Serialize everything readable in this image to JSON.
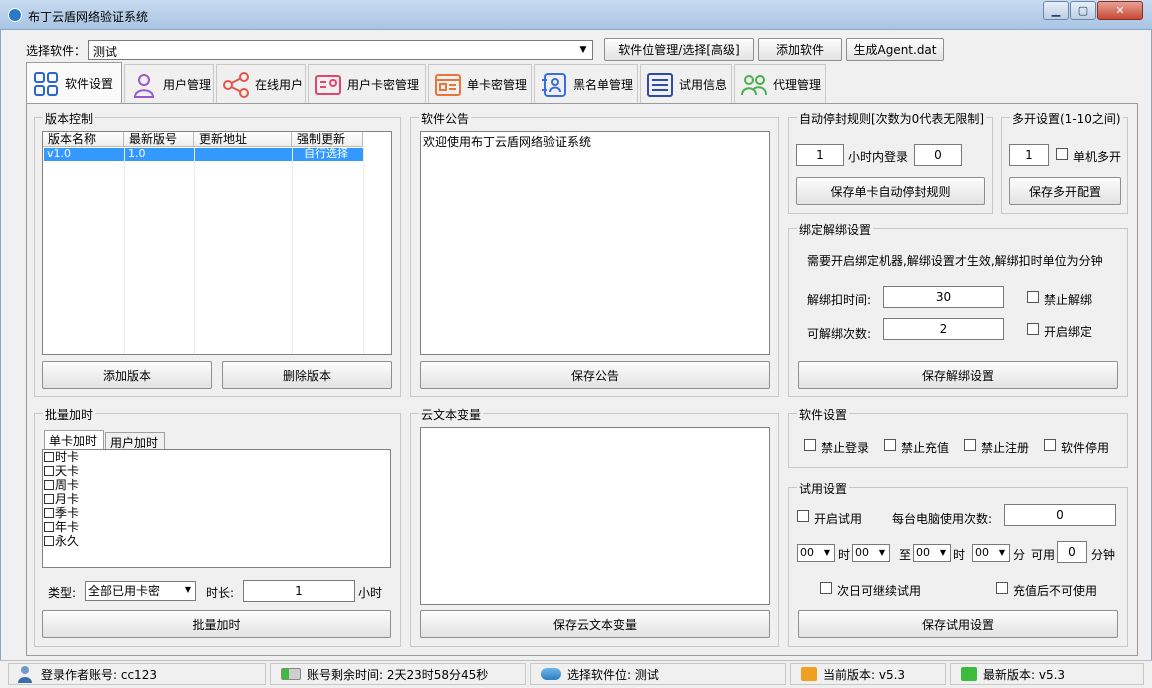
{
  "window": {
    "title": "布丁云盾网络验证系统"
  },
  "toolbar": {
    "select_label": "选择软件：",
    "select_value": "测试",
    "btn_manage": "软件位管理/选择[高级]",
    "btn_add": "添加软件",
    "btn_gen": "生成Agent.dat"
  },
  "tabs": [
    {
      "label": "软件设置"
    },
    {
      "label": "用户管理"
    },
    {
      "label": "在线用户"
    },
    {
      "label": "用户卡密管理"
    },
    {
      "label": "单卡密管理"
    },
    {
      "label": "黑名单管理"
    },
    {
      "label": "试用信息"
    },
    {
      "label": "代理管理"
    }
  ],
  "version": {
    "title": "版本控制",
    "columns": [
      "版本名称",
      "最新版号",
      "更新地址",
      "强制更新"
    ],
    "rows": [
      {
        "name": "v1.0",
        "num": "1.0",
        "url": "",
        "force": "自行选择"
      }
    ],
    "btn_add": "添加版本",
    "btn_del": "删除版本"
  },
  "notice": {
    "title": "软件公告",
    "content": "欢迎使用布丁云盾网络验证系统",
    "btn_save": "保存公告"
  },
  "autoban": {
    "title": "自动停封规则[次数为0代表无限制]",
    "hours": "1",
    "hours_label": "小时内登录",
    "count": "0",
    "btn_save": "保存单卡自动停封规则"
  },
  "multi": {
    "title": "多开设置(1-10之间)",
    "value": "1",
    "check_label": "单机多开",
    "btn_save": "保存多开配置"
  },
  "bind": {
    "title": "绑定解绑设置",
    "desc": "需要开启绑定机器,解绑设置才生效,解绑扣时单位为分钟",
    "deduct_label": "解绑扣时间:",
    "deduct_value": "30",
    "times_label": "可解绑次数:",
    "times_value": "2",
    "check_forbid": "禁止解绑",
    "check_enable": "开启绑定",
    "btn_save": "保存解绑设置"
  },
  "batch": {
    "title": "批量加时",
    "subtabs": [
      "单卡加时",
      "用户加时"
    ],
    "cards": [
      "时卡",
      "天卡",
      "周卡",
      "月卡",
      "季卡",
      "年卡",
      "永久"
    ],
    "type_label": "类型:",
    "type_value": "全部已用卡密",
    "duration_label": "时长:",
    "duration_value": "1",
    "unit": "小时",
    "btn": "批量加时"
  },
  "cloud": {
    "title": "云文本变量",
    "btn_save": "保存云文本变量"
  },
  "soft": {
    "title": "软件设置",
    "checks": [
      "禁止登录",
      "禁止充值",
      "禁止注册",
      "软件停用"
    ]
  },
  "trial": {
    "title": "试用设置",
    "check_enable": "开启试用",
    "per_pc_label": "每台电脑使用次数:",
    "per_pc_value": "0",
    "h1": "00",
    "m1": "00",
    "h2": "00",
    "m2": "00",
    "t_hour": "时",
    "t_to": "至",
    "t_min": "分",
    "t_avail": "可用",
    "avail_value": "0",
    "t_minute": "分钟",
    "check_next": "次日可继续试用",
    "check_recharge": "充值后不可使用",
    "btn_save": "保存试用设置"
  },
  "status": {
    "account": "登录作者账号: cc123",
    "remain": "账号剩余时间: 2天23时58分45秒",
    "selected": "选择软件位: 测试",
    "current": "当前版本: v5.3",
    "latest": "最新版本: v5.3"
  },
  "colors": {
    "selection": "#3399ff",
    "titlebar": "#b9d1ea"
  }
}
